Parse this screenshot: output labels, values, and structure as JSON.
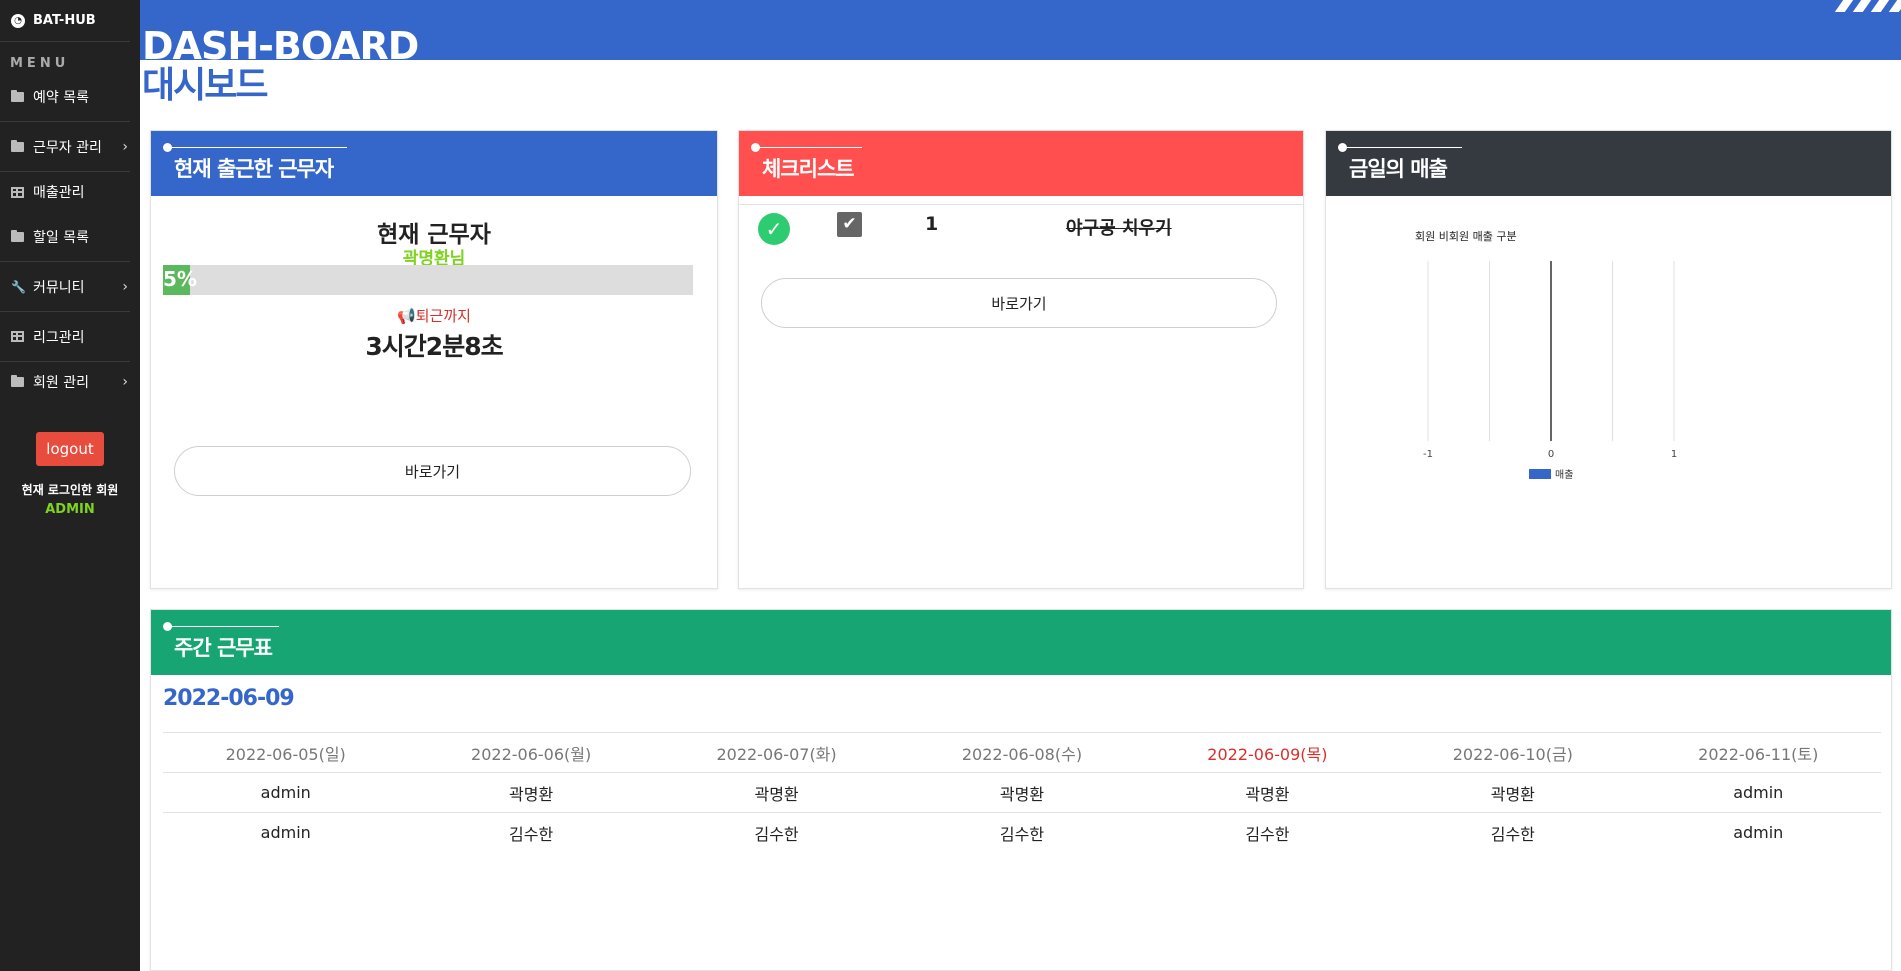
{
  "sidebar": {
    "brand": "BAT-HUB",
    "menu_title": "MENU",
    "items": [
      {
        "label": "예약 목록",
        "icon": "folder-icon",
        "chevron": false
      },
      {
        "label": "근무자 관리",
        "icon": "folder-icon",
        "chevron": true
      },
      {
        "label": "매출관리",
        "icon": "table-icon",
        "chevron": false
      },
      {
        "label": "할일 목록",
        "icon": "folder-icon",
        "chevron": false
      },
      {
        "label": "커뮤니티",
        "icon": "wrench-icon",
        "chevron": true
      },
      {
        "label": "리그관리",
        "icon": "table-icon",
        "chevron": false
      },
      {
        "label": "회원 관리",
        "icon": "folder-icon",
        "chevron": true
      }
    ],
    "logout_label": "logout",
    "login_label": "현재 로그인한 회원",
    "login_user": "ADMIN"
  },
  "header": {
    "title": "DASH-BOARD",
    "subtitle": "대시보드"
  },
  "card_worker": {
    "title": "현재 출근한 근무자",
    "subtitle": "현재 근무자",
    "name": "곽명환님",
    "progress_label": "5%",
    "progress": 0.05,
    "until_label": "퇴근까지",
    "remaining": "3시간2분8초",
    "button": "바로가기"
  },
  "card_checklist": {
    "title": "체크리스트",
    "items": [
      {
        "num": "1",
        "text": "야구공 치우기",
        "done": true
      }
    ],
    "button": "바로가기"
  },
  "card_sales": {
    "title": "금일의 매출",
    "chart_data": {
      "type": "bar",
      "title": "회원 비회원 매출 구분",
      "categories": [],
      "series": [
        {
          "name": "매출",
          "values": []
        }
      ],
      "xlim": [
        -1,
        1
      ],
      "xticks": [
        "-1",
        "0",
        "1"
      ],
      "legend": "bottom",
      "color": "#3566c9"
    }
  },
  "card_schedule": {
    "title": "주간 근무표",
    "date": "2022-06-09",
    "headers": [
      "2022-06-05(일)",
      "2022-06-06(월)",
      "2022-06-07(화)",
      "2022-06-08(수)",
      "2022-06-09(목)",
      "2022-06-10(금)",
      "2022-06-11(토)"
    ],
    "today_index": 4,
    "rows": [
      [
        "admin",
        "곽명환",
        "곽명환",
        "곽명환",
        "곽명환",
        "곽명환",
        "admin"
      ],
      [
        "admin",
        "김수한",
        "김수한",
        "김수한",
        "김수한",
        "김수한",
        "admin"
      ]
    ]
  },
  "colors": {
    "primary": "#3566c9",
    "danger": "#ff4f4f",
    "dark": "#343a40",
    "success": "#17a673"
  }
}
